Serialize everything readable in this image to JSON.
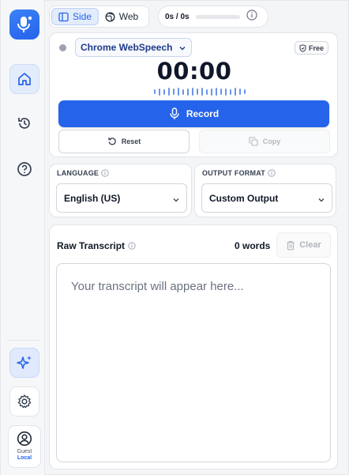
{
  "sidebar": {
    "guest_label": "Guest",
    "local_label": "Local"
  },
  "mode_toggle": {
    "side_label": "Side",
    "web_label": "Web"
  },
  "usage": {
    "text": "0s / 0s",
    "progress_fraction": 0
  },
  "recorder": {
    "engine_label": "Chrome WebSpeech",
    "plan_badge": "Free",
    "timer": "00:00",
    "record_label": "Record",
    "reset_label": "Reset",
    "copy_label": "Copy"
  },
  "settings": {
    "language_label": "LANGUAGE",
    "language_value": "English (US)",
    "output_label": "OUTPUT FORMAT",
    "output_value": "Custom Output"
  },
  "transcript": {
    "title": "Raw Transcript",
    "word_count": "0 words",
    "clear_label": "Clear",
    "placeholder": "Your transcript will appear here..."
  },
  "colors": {
    "accent": "#2563eb",
    "accent_light": "#e3ecfb",
    "text_dark": "#0f172a",
    "muted": "#6b7280"
  }
}
